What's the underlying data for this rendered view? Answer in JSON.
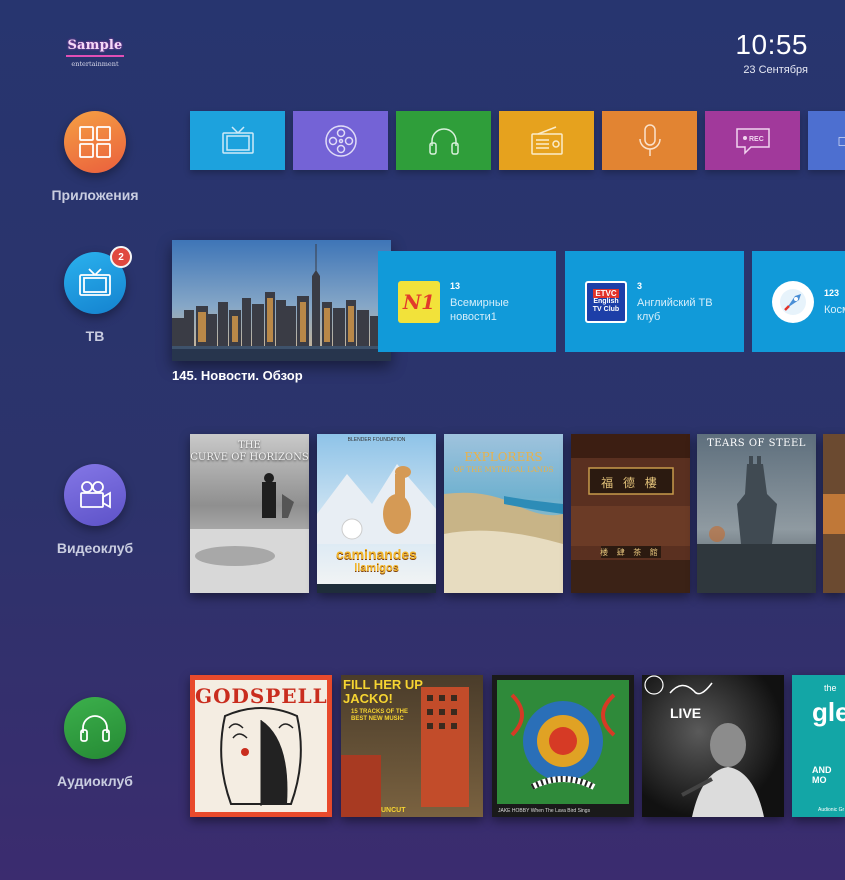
{
  "brand": {
    "name": "Sample",
    "tagline": "entertainment"
  },
  "clock": {
    "time": "10:55",
    "date": "23 Сентября"
  },
  "categories": [
    {
      "label": "Приложения",
      "icon": "grid-icon",
      "color": "#f07a3b"
    },
    {
      "label": "ТВ",
      "icon": "tv-icon",
      "color": "#1a9be0",
      "badge": "2"
    },
    {
      "label": "Видеоклуб",
      "icon": "video-camera-icon",
      "color": "#6f63d8"
    },
    {
      "label": "Аудиоклуб",
      "icon": "headphones-icon",
      "color": "#2e9e40"
    }
  ],
  "apps": [
    {
      "icon": "tv-icon",
      "color": "#1da2dd"
    },
    {
      "icon": "film-reel-icon",
      "color": "#7463d6"
    },
    {
      "icon": "headphones-icon",
      "color": "#2f9e3a"
    },
    {
      "icon": "radio-icon",
      "color": "#e6a21e"
    },
    {
      "icon": "microphone-icon",
      "color": "#e28432"
    },
    {
      "icon": "rec-icon",
      "color": "#a1399b",
      "label": "● REC"
    },
    {
      "icon": "tv-icon",
      "color": "#4d6fd0"
    }
  ],
  "tv": {
    "featured_caption": "145.  Новости. Обзор",
    "channels": [
      {
        "number": "13",
        "name_line1": "Всемирные",
        "name_line2": "новости1",
        "logo_text": "N1"
      },
      {
        "number": "3",
        "name_line1": "Английский ТВ",
        "name_line2": "клуб",
        "logo_text_1": "ETVC",
        "logo_text_2": "English",
        "logo_text_3": "TV Club"
      },
      {
        "number": "123",
        "name_line1": "Косм",
        "name_line2": ""
      }
    ]
  },
  "videos": [
    {
      "title_1": "THE",
      "title_2": "CURVE OF HORIZONS"
    },
    {
      "top_text": "BLENDER FOUNDATION",
      "title_1": "caminandes",
      "title_2": "llamigos"
    },
    {
      "title_1": "EXPLORERS",
      "title_2": "OF THE MYTHICAL LANDS"
    },
    {
      "sign_1": "福 德 樓",
      "sign_2": "楼 肆 茶 館"
    },
    {
      "title_1": "TEARS OF STEEL"
    }
  ],
  "albums": [
    {
      "title": "GODSPELL"
    },
    {
      "line1": "FILL HER UP",
      "line2": "JACKO!",
      "line3": "15 TRACKS OF THE",
      "line4": "BEST NEW MUSIC",
      "footer": "UNCUT"
    },
    {
      "footer": "JAKE HOBBY  When The Lava Bird Sings"
    },
    {
      "title": "LIVE"
    },
    {
      "title_1": "the",
      "title_2": "gle",
      "title_3": "AND MO",
      "footer": "Audionic Gr"
    }
  ]
}
